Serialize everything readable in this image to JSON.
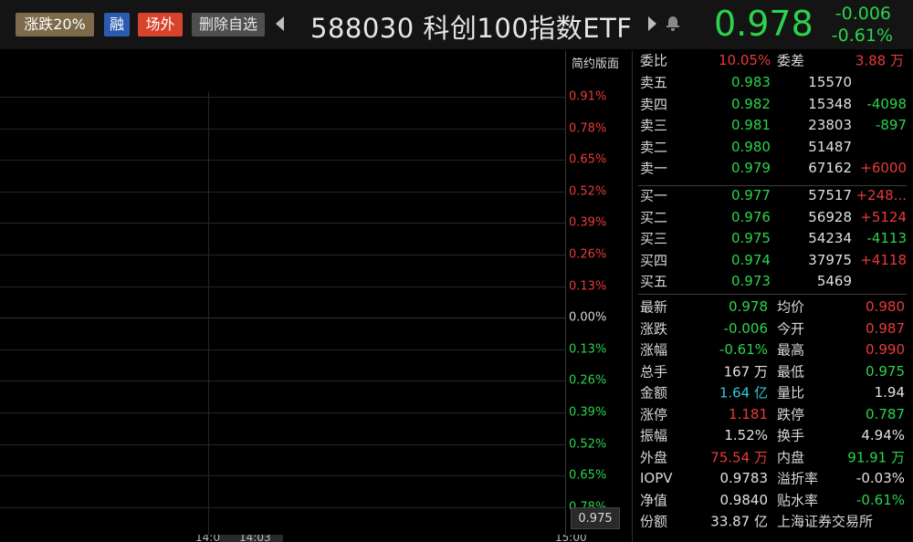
{
  "header": {
    "limit_tag": "涨跌20%",
    "margin_tag": "融",
    "otc_tag": "场外",
    "remove_watchlist": "删除自选",
    "code_name": "588030 科创100指数ETF",
    "price": "0.978",
    "change": "-0.006",
    "change_pct": "-0.61%",
    "colors": {
      "down": "#2ad44c",
      "up": "#e83a3a",
      "accent_tag": "#d8432c"
    }
  },
  "chart": {
    "layout_button": "简约版面",
    "scale_labels": [
      "0.91%",
      "0.78%",
      "0.65%",
      "0.52%",
      "0.39%",
      "0.26%",
      "0.13%",
      "0.00%",
      "0.13%",
      "0.26%",
      "0.39%",
      "0.52%",
      "0.65%",
      "0.78%"
    ],
    "cursor_price": "0.975",
    "time_labels": [
      "14:0",
      "14:03",
      "15:00"
    ]
  },
  "quote": {
    "commission_ratio_label": "委比",
    "commission_ratio": "10.05%",
    "commission_diff_label": "委差",
    "commission_diff": "3.88 万",
    "asks": [
      {
        "label": "卖五",
        "price": "0.983",
        "volume": "15570",
        "delta": ""
      },
      {
        "label": "卖四",
        "price": "0.982",
        "volume": "15348",
        "delta": "-4098"
      },
      {
        "label": "卖三",
        "price": "0.981",
        "volume": "23803",
        "delta": "-897"
      },
      {
        "label": "卖二",
        "price": "0.980",
        "volume": "51487",
        "delta": ""
      },
      {
        "label": "卖一",
        "price": "0.979",
        "volume": "67162",
        "delta": "+6000"
      }
    ],
    "bids": [
      {
        "label": "买一",
        "price": "0.977",
        "volume": "57517",
        "delta": "+248..."
      },
      {
        "label": "买二",
        "price": "0.976",
        "volume": "56928",
        "delta": "+5124"
      },
      {
        "label": "买三",
        "price": "0.975",
        "volume": "54234",
        "delta": "-4113"
      },
      {
        "label": "买四",
        "price": "0.974",
        "volume": "37975",
        "delta": "+4118"
      },
      {
        "label": "买五",
        "price": "0.973",
        "volume": "5469",
        "delta": ""
      }
    ],
    "stats": [
      {
        "l1": "最新",
        "v1": "0.978",
        "l2": "均价",
        "v2": "0.980"
      },
      {
        "l1": "涨跌",
        "v1": "-0.006",
        "l2": "今开",
        "v2": "0.987"
      },
      {
        "l1": "涨幅",
        "v1": "-0.61%",
        "l2": "最高",
        "v2": "0.990"
      },
      {
        "l1": "总手",
        "v1": "167 万",
        "l2": "最低",
        "v2": "0.975"
      },
      {
        "l1": "金额",
        "v1": "1.64 亿",
        "l2": "量比",
        "v2": "1.94"
      },
      {
        "l1": "涨停",
        "v1": "1.181",
        "l2": "跌停",
        "v2": "0.787"
      },
      {
        "l1": "振幅",
        "v1": "1.52%",
        "l2": "换手",
        "v2": "4.94%"
      },
      {
        "l1": "外盘",
        "v1": "75.54 万",
        "l2": "内盘",
        "v2": "91.91 万"
      },
      {
        "l1": "IOPV",
        "v1": "0.9783",
        "l2": "溢折率",
        "v2": "-0.03%"
      },
      {
        "l1": "净值",
        "v1": "0.9840",
        "l2": "贴水率",
        "v2": "-0.61%"
      },
      {
        "l1": "份额",
        "v1": "33.87 亿",
        "l2": "上海证券交易所",
        "v2": ""
      }
    ]
  }
}
